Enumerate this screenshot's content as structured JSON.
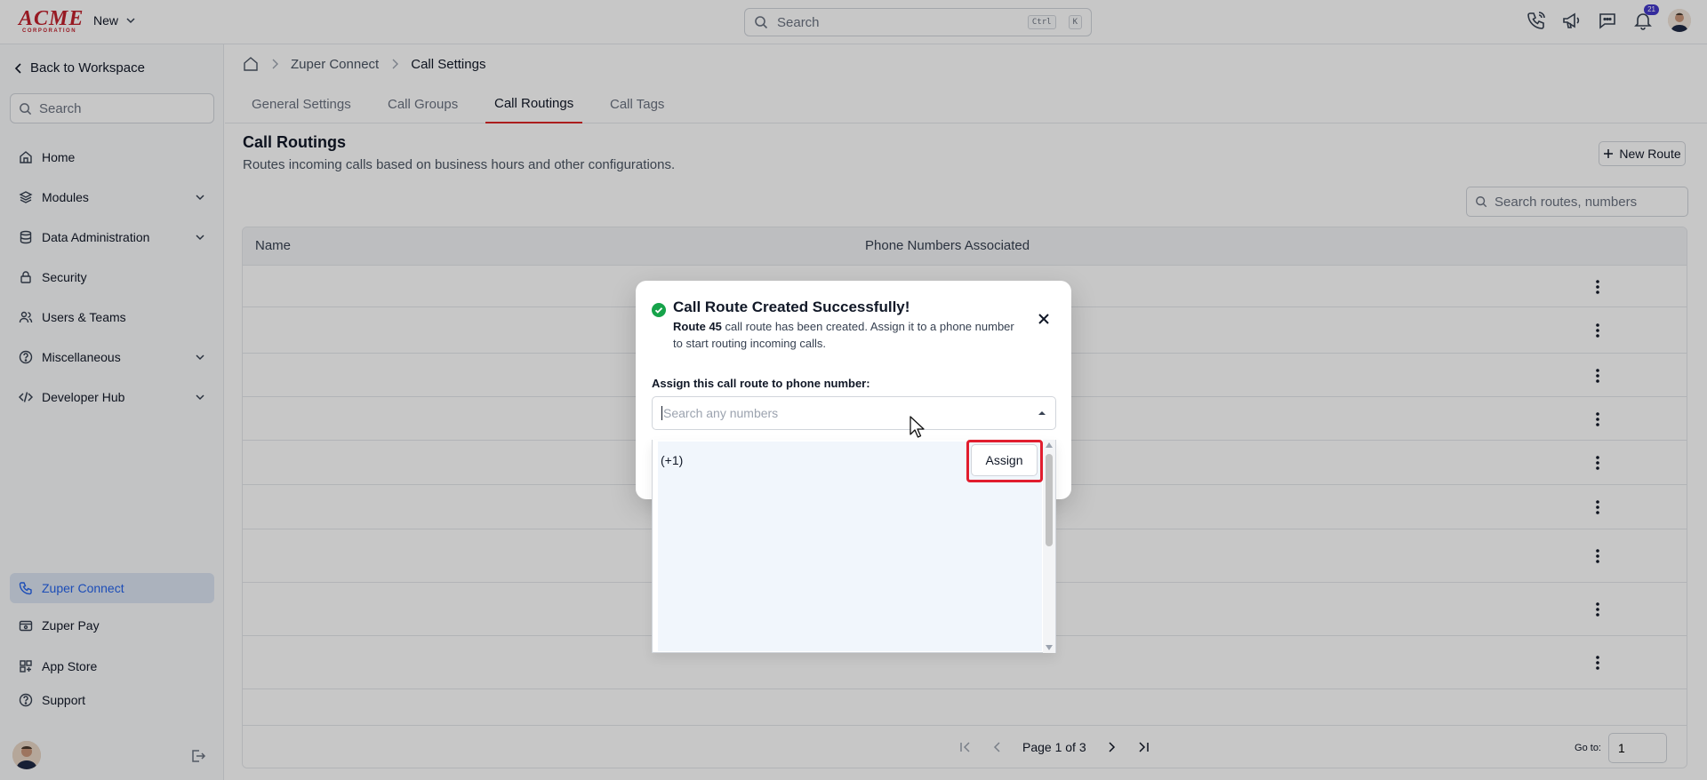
{
  "header": {
    "logo_text": "ACME",
    "logo_subtext": "CORPORATION",
    "new_label": "New",
    "search_placeholder": "Search",
    "shortcut_ctrl": "Ctrl",
    "shortcut_key": "K",
    "notification_count": "21"
  },
  "sidebar": {
    "back_label": "Back to Workspace",
    "search_placeholder": "Search",
    "items": [
      {
        "label": "Home",
        "icon": "home-icon"
      },
      {
        "label": "Modules",
        "icon": "layers-icon"
      },
      {
        "label": "Data Administration",
        "icon": "database-icon"
      },
      {
        "label": "Security",
        "icon": "lock-icon"
      },
      {
        "label": "Users & Teams",
        "icon": "users-icon"
      },
      {
        "label": "Miscellaneous",
        "icon": "help-circle-icon"
      },
      {
        "label": "Developer Hub",
        "icon": "code-icon"
      }
    ],
    "bottom_items": [
      {
        "label": "Zuper Connect",
        "icon": "phone-icon"
      },
      {
        "label": "Zuper Pay",
        "icon": "wallet-icon"
      },
      {
        "label": "App Store",
        "icon": "grid-icon"
      },
      {
        "label": "Support",
        "icon": "help-circle-icon"
      }
    ],
    "active_item": "Zuper Connect"
  },
  "breadcrumb": {
    "items": [
      "Zuper Connect",
      "Call Settings"
    ]
  },
  "tabs": [
    "General Settings",
    "Call Groups",
    "Call Routings",
    "Call Tags"
  ],
  "active_tab": "Call Routings",
  "page": {
    "title": "Call Routings",
    "subtitle": "Routes incoming calls based on business hours and other configurations.",
    "new_route_label": "New Route",
    "search_placeholder": "Search routes, numbers"
  },
  "table": {
    "columns": [
      "Name",
      "Phone Numbers Associated"
    ],
    "row_count": 9
  },
  "pagination": {
    "label": "Page 1 of 3",
    "goto_label": "Go to:",
    "goto_value": "1"
  },
  "modal": {
    "title": "Call Route Created Successfully!",
    "route_name": "Route 45",
    "message": " call route has been created. Assign it to a phone number to start routing incoming calls.",
    "assign_label": "Assign this call route to phone number:",
    "select_placeholder": "Search any numbers",
    "option_text": "(+1) ",
    "assign_button": "Assign"
  },
  "colors": {
    "accent": "#2563eb",
    "active_tab_underline": "#dc2626",
    "success": "#16a34a",
    "highlight": "#e11d2e",
    "brand": "#c2202c"
  }
}
